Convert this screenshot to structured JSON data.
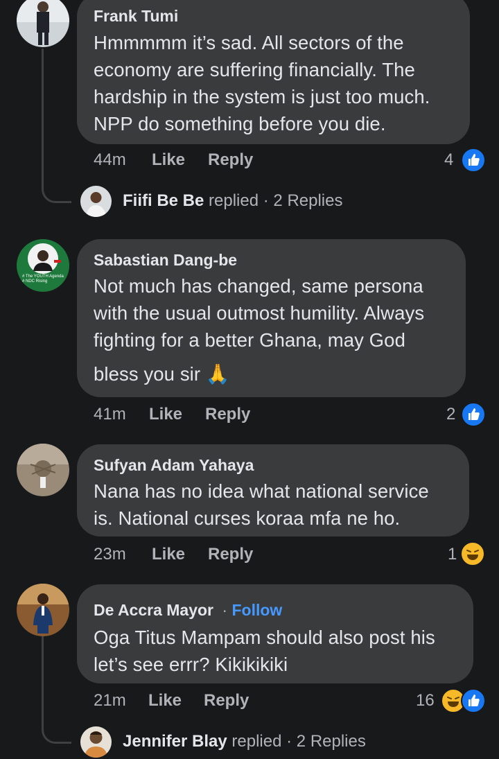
{
  "comments": [
    {
      "author": "Frank Tumi",
      "lines": [
        "Hmmmmm it’s sad.  All sectors of the",
        "economy are suffering financially. The",
        "hardship in the system is just too much.",
        "NPP do something before you die."
      ],
      "time": "44m",
      "like": "Like",
      "reply": "Reply",
      "reaction_count": "4",
      "reactions": [
        "like"
      ],
      "replies": {
        "name": "Fiifi Be Be",
        "verb": "replied",
        "sep": "·",
        "count": "2 Replies"
      }
    },
    {
      "author": "Sabastian Dang-be",
      "lines": [
        "Not much has changed, same persona",
        "with the usual outmost humility. Always",
        "fighting for a better Ghana, may God",
        "bless you sir"
      ],
      "emoji": "🙏",
      "avatar_text": [
        "# The YOUTH Agenda",
        "# NDC Rising"
      ],
      "time": "41m",
      "like": "Like",
      "reply": "Reply",
      "reaction_count": "2",
      "reactions": [
        "like"
      ]
    },
    {
      "author": "Sufyan Adam Yahaya",
      "lines": [
        "Nana has no idea what  national service",
        "is. National curses koraa mfa ne ho."
      ],
      "time": "23m",
      "like": "Like",
      "reply": "Reply",
      "reaction_count": "1",
      "reactions": [
        "haha"
      ]
    },
    {
      "author": "De Accra Mayor",
      "sep": "·",
      "follow": "Follow",
      "lines": [
        "Oga Titus Mampam should also post his",
        "let’s see errr? Kikikikiki"
      ],
      "time": "21m",
      "like": "Like",
      "reply": "Reply",
      "reaction_count": "16",
      "reactions": [
        "haha",
        "like"
      ],
      "replies": {
        "name": "Jennifer Blay",
        "verb": "replied",
        "sep": "·",
        "count": "2 Replies"
      }
    }
  ],
  "colors": {
    "background": "#18191a",
    "bubble": "#3a3b3c",
    "like_blue": "#1877f2",
    "haha_yellow": "#f7b928",
    "follow_blue": "#4599ff"
  },
  "icons": {
    "like": "thumbs-up-icon",
    "haha": "laughing-face-icon"
  }
}
